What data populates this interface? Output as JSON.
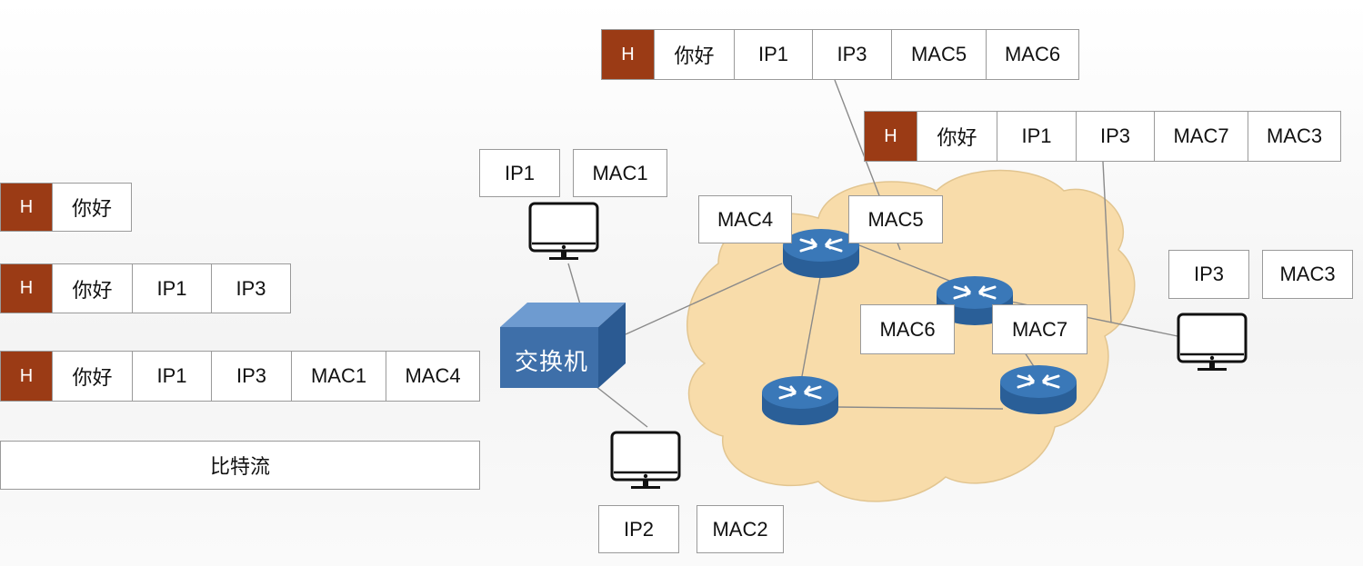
{
  "packets": {
    "data_only": {
      "header": "H",
      "payload": "你好"
    },
    "ip_packet": {
      "header": "H",
      "payload": "你好",
      "src_ip": "IP1",
      "dst_ip": "IP3"
    },
    "frame_1": {
      "header": "H",
      "payload": "你好",
      "src_ip": "IP1",
      "dst_ip": "IP3",
      "src_mac": "MAC1",
      "dst_mac": "MAC4"
    },
    "bitstream": "比特流",
    "frame_2": {
      "header": "H",
      "payload": "你好",
      "src_ip": "IP1",
      "dst_ip": "IP3",
      "src_mac": "MAC5",
      "dst_mac": "MAC6"
    },
    "frame_3": {
      "header": "H",
      "payload": "你好",
      "src_ip": "IP1",
      "dst_ip": "IP3",
      "src_mac": "MAC7",
      "dst_mac": "MAC3"
    }
  },
  "hosts": {
    "host1": {
      "ip": "IP1",
      "mac": "MAC1"
    },
    "host2": {
      "ip": "IP2",
      "mac": "MAC2"
    },
    "host3": {
      "ip": "IP3",
      "mac": "MAC3"
    }
  },
  "switch": {
    "label": "交换机"
  },
  "routers": {
    "r1_mac4": "MAC4",
    "r1_mac5": "MAC5",
    "r2_mac6": "MAC6",
    "r2_mac7": "MAC7"
  },
  "colors": {
    "header": "#9b3b15",
    "cloud": "#f8dcaa",
    "router": "#2f6aa8",
    "switch": "#3e6fa9"
  }
}
